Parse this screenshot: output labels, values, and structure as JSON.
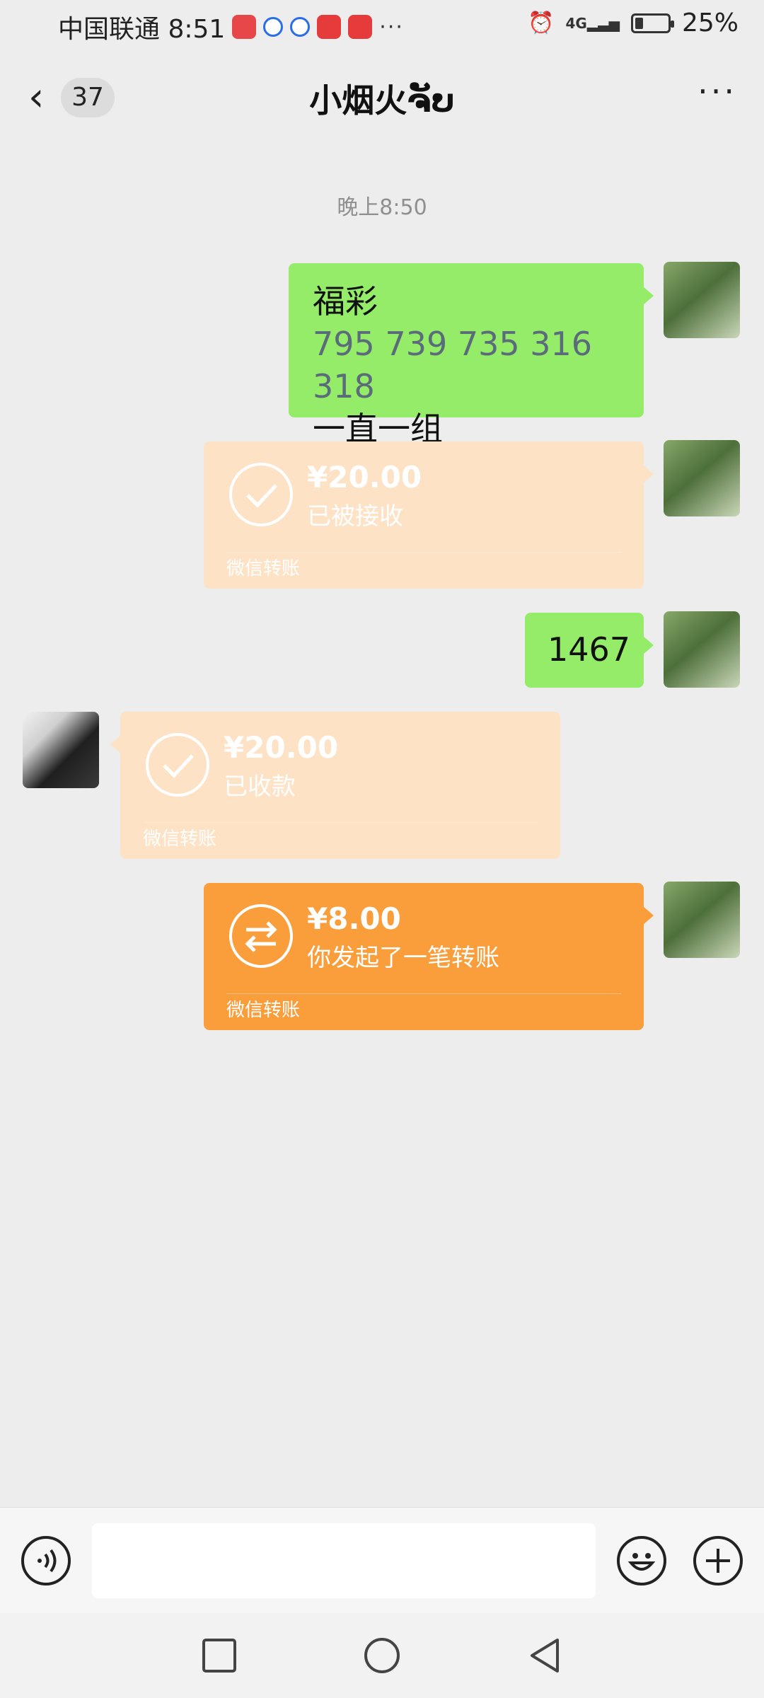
{
  "status_bar": {
    "carrier_time": "中国联通 8:51",
    "more_notifications": "···",
    "network": "4G",
    "battery_level": 0.25,
    "battery_text": "25%"
  },
  "header": {
    "unread_count": "37",
    "title": "小烟火ຈັບ"
  },
  "timestamp": "晚上8:50",
  "messages": {
    "m1": {
      "lines": [
        "福彩",
        "795 739 735 316 318",
        "一直一组"
      ]
    },
    "m2": {
      "amount": "¥20.00",
      "status": "已被接收",
      "footer": "微信转账"
    },
    "m3": {
      "text": "1467"
    },
    "m4": {
      "amount": "¥20.00",
      "status": "已收款",
      "footer": "微信转账"
    },
    "m5": {
      "amount": "¥8.00",
      "status": "你发起了一笔转账",
      "footer": "微信转账"
    }
  },
  "colors": {
    "background": "#ededed",
    "sent_bubble": "#95ec69",
    "transfer_done": "#fde2c5",
    "transfer_active": "#fa9d3b"
  }
}
